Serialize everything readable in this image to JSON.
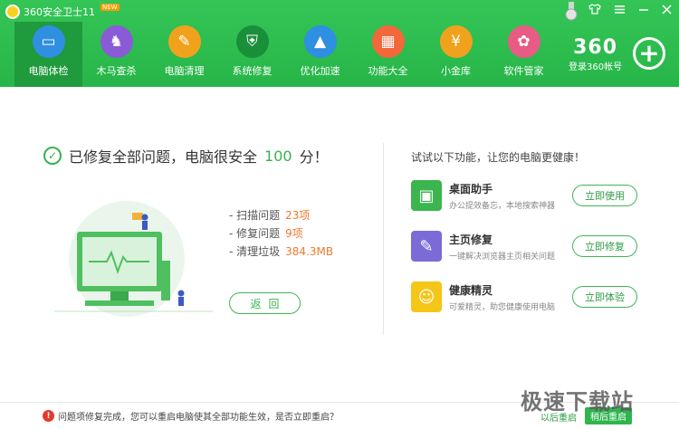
{
  "window": {
    "title": "360安全卫士11",
    "badge": "NEW",
    "controls": [
      "shirt-icon",
      "menu-icon",
      "minimize-icon",
      "close-icon"
    ]
  },
  "nav": {
    "items": [
      {
        "label": "电脑体检",
        "icon": "monitor-check-icon",
        "color": "#2f8fe0",
        "active": true
      },
      {
        "label": "木马查杀",
        "icon": "horse-icon",
        "color": "#8a5bd6"
      },
      {
        "label": "电脑清理",
        "icon": "broom-icon",
        "color": "#f0a21d"
      },
      {
        "label": "系统修复",
        "icon": "shield-icon",
        "color": "#1a8f3a"
      },
      {
        "label": "优化加速",
        "icon": "rocket-icon",
        "color": "#2f8fe0"
      },
      {
        "label": "功能大全",
        "icon": "grid-icon",
        "color": "#f2683a"
      },
      {
        "label": "小金库",
        "icon": "money-bag-icon",
        "color": "#f0a21d"
      },
      {
        "label": "软件管家",
        "icon": "app-store-icon",
        "color": "#e85b84"
      }
    ]
  },
  "account": {
    "brand": "360",
    "login": "登录360帐号"
  },
  "result": {
    "prefix": "已修复全部问题，电脑很安全",
    "score": "100",
    "suffix": "分！"
  },
  "stats": [
    {
      "label": "- 扫描问题",
      "value": "23项"
    },
    {
      "label": "- 修复问题",
      "value": "9项"
    },
    {
      "label": "- 清理垃圾",
      "value": "384.3MB"
    }
  ],
  "back_label": "返回",
  "recommend": {
    "heading": "试试以下功能，让您的电脑更健康！",
    "items": [
      {
        "name": "桌面助手",
        "desc": "办公提效备忘，本地搜索神器",
        "button": "立即使用",
        "icon": "desktop-assistant-icon",
        "color": "#3cb54e"
      },
      {
        "name": "主页修复",
        "desc": "一键解决浏览器主页相关问题",
        "button": "立即修复",
        "icon": "wrench-icon",
        "color": "#7b6bd6"
      },
      {
        "name": "健康精灵",
        "desc": "可爱精灵，助您健康使用电脑",
        "button": "立即体验",
        "icon": "android-sprite-icon",
        "color": "#f5c518"
      }
    ]
  },
  "footer": {
    "message": "问题项修复完成，您可以重启电脑使其全部功能生效，是否立即重启？",
    "later": "以后重启",
    "restart": "稍后重启"
  },
  "watermark": "极速下载站"
}
